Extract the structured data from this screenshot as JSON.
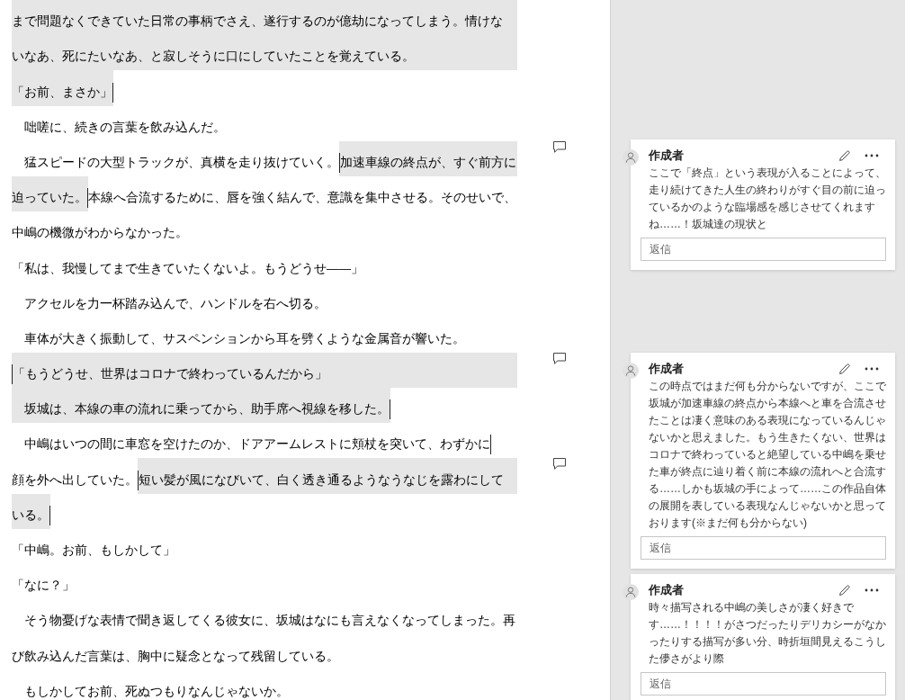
{
  "document": {
    "paragraphs": [
      {
        "lines": [
          {
            "comment_icon": false,
            "segments": [
              {
                "text": "まで問題なくできていた日常の事柄でさえ、遂行するのが億劫になってしまう。情けな",
                "highlighted": true,
                "range_start": false,
                "range_end": false
              }
            ]
          },
          {
            "comment_icon": false,
            "segments": [
              {
                "text": "いなあ、死にたいなあ、と寂しそうに口にしていたことを覚えている。",
                "highlighted": true,
                "range_start": false,
                "range_end": false
              }
            ]
          }
        ]
      },
      {
        "lines": [
          {
            "comment_icon": false,
            "segments": [
              {
                "text": "「お前、まさか」",
                "highlighted": true,
                "range_start": false,
                "range_end": true
              }
            ]
          }
        ]
      },
      {
        "lines": [
          {
            "comment_icon": false,
            "segments": [
              {
                "text": "　咄嗟に、続きの言葉を飲み込んだ。",
                "highlighted": false,
                "range_start": false,
                "range_end": false
              }
            ]
          }
        ]
      },
      {
        "lines": [
          {
            "comment_icon": true,
            "segments": [
              {
                "text": "　猛スピードの大型トラックが、真横を走り抜けていく。",
                "highlighted": false,
                "range_start": false,
                "range_end": false
              },
              {
                "text": "加速車線の終点が、すぐ前方に",
                "highlighted": true,
                "range_start": true,
                "range_end": false
              }
            ]
          },
          {
            "comment_icon": false,
            "segments": [
              {
                "text": "迫っていた。",
                "highlighted": true,
                "range_start": false,
                "range_end": true
              },
              {
                "text": "本線へ合流するために、唇を強く結んで、意識を集中させる。そのせいで、",
                "highlighted": false,
                "range_start": false,
                "range_end": false
              }
            ]
          },
          {
            "comment_icon": false,
            "segments": [
              {
                "text": "中嶋の機微がわからなかった。",
                "highlighted": false,
                "range_start": false,
                "range_end": false
              }
            ]
          }
        ]
      },
      {
        "lines": [
          {
            "comment_icon": false,
            "segments": [
              {
                "text": "「私は、我慢してまで生きていたくないよ。もうどうせ――」",
                "highlighted": false,
                "range_start": false,
                "range_end": false
              }
            ]
          }
        ]
      },
      {
        "lines": [
          {
            "comment_icon": false,
            "segments": [
              {
                "text": "　アクセルを力一杯踏み込んで、ハンドルを右へ切る。",
                "highlighted": false,
                "range_start": false,
                "range_end": false
              }
            ]
          }
        ]
      },
      {
        "lines": [
          {
            "comment_icon": false,
            "segments": [
              {
                "text": "　車体が大きく振動して、サスペンションから耳を劈くような金属音が響いた。",
                "highlighted": false,
                "range_start": false,
                "range_end": false
              }
            ]
          }
        ]
      },
      {
        "lines": [
          {
            "comment_icon": true,
            "segments": [
              {
                "text": "「もうどうせ、世界はコロナで終わっているんだから」",
                "highlighted": true,
                "range_start": true,
                "range_end": false
              }
            ]
          }
        ]
      },
      {
        "lines": [
          {
            "comment_icon": false,
            "segments": [
              {
                "text": "　坂城は、本線の車の流れに乗ってから、助手席へ視線を移した。",
                "highlighted": true,
                "range_start": false,
                "range_end": true
              }
            ]
          }
        ]
      },
      {
        "lines": [
          {
            "comment_icon": false,
            "segments": [
              {
                "text": "　中嶋はいつの間に車窓を空けたのか、ドアアームレストに頬杖を突いて、わずかに",
                "highlighted": false,
                "range_start": false,
                "range_end": true
              }
            ]
          },
          {
            "comment_icon": true,
            "segments": [
              {
                "text": "顔を外へ出していた。",
                "highlighted": false,
                "range_start": false,
                "range_end": false
              },
              {
                "text": "短い髪が風になびいて、白く透き通るようなうなじを露わにして",
                "highlighted": true,
                "range_start": true,
                "range_end": false
              }
            ]
          },
          {
            "comment_icon": false,
            "segments": [
              {
                "text": "いる。",
                "highlighted": true,
                "range_start": false,
                "range_end": true
              }
            ]
          }
        ]
      },
      {
        "lines": [
          {
            "comment_icon": false,
            "segments": [
              {
                "text": "「中嶋。お前、もしかして」",
                "highlighted": false,
                "range_start": false,
                "range_end": false
              }
            ]
          }
        ]
      },
      {
        "lines": [
          {
            "comment_icon": false,
            "segments": [
              {
                "text": "「なに？」",
                "highlighted": false,
                "range_start": false,
                "range_end": false
              }
            ]
          }
        ]
      },
      {
        "lines": [
          {
            "comment_icon": false,
            "segments": [
              {
                "text": "　そう物憂げな表情で聞き返してくる彼女に、坂城はなにも言えなくなってしまった。再",
                "highlighted": false,
                "range_start": false,
                "range_end": false
              }
            ]
          },
          {
            "comment_icon": false,
            "segments": [
              {
                "text": "び飲み込んだ言葉は、胸中に疑念となって残留している。",
                "highlighted": false,
                "range_start": false,
                "range_end": false
              }
            ]
          }
        ]
      },
      {
        "lines": [
          {
            "comment_icon": false,
            "segments": [
              {
                "text": "　もしかしてお前、死ぬつもりなんじゃないか。",
                "highlighted": false,
                "range_start": false,
                "range_end": false
              }
            ]
          }
        ]
      }
    ]
  },
  "comments_pane": {
    "comments": [
      {
        "author": "作成者",
        "text": "ここで「終点」という表現が入ることによって、走り続けてきた人生の終わりがすぐ目の前に迫っているかのような臨場感を感じさせてくれますね……！坂城達の現状と",
        "reply_placeholder": "返信"
      },
      {
        "author": "作成者",
        "text": "この時点ではまだ何も分からないですが、ここで坂城が加速車線の終点から本線へと車を合流させたことは凄く意味のある表現になっているんじゃないかと思えました。もう生きたくない、世界はコロナで終わっていると絶望している中嶋を乗せた車が終点に辿り着く前に本線の流れへと合流する……しかも坂城の手によって……この作品自体の展開を表している表現なんじゃないかと思っております(※まだ何も分からない)",
        "reply_placeholder": "返信"
      },
      {
        "author": "作成者",
        "text": "時々描写される中嶋の美しさが凄く好きです……！！！！がさつだったりデリカシーがなかったりする描写が多い分、時折垣間見えるこうした儚さがより際",
        "reply_placeholder": "返信"
      }
    ]
  }
}
